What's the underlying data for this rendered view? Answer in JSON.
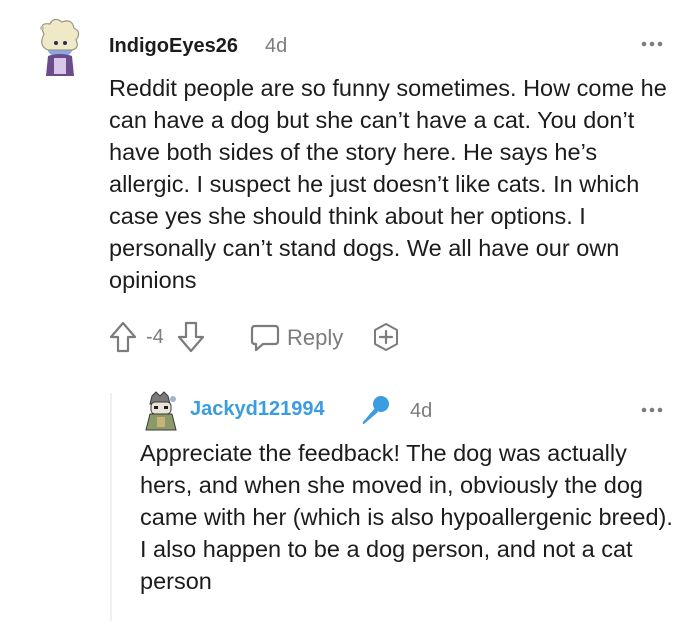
{
  "comment": {
    "author": "IndigoEyes26",
    "age": "4d",
    "body": "Reddit people are so funny sometimes. How come he can have a dog but she can’t have a cat. You don’t have both sides of the story here. He says he’s allergic. I suspect he just doesn’t like cats. In which case yes she should think about her options. I personally can’t stand dogs. We all have our own opinions",
    "score": "-4",
    "reply_label": "Reply",
    "icons": [
      "more-options-icon",
      "upvote-icon",
      "downvote-icon",
      "reply-icon",
      "award-icon"
    ]
  },
  "reply": {
    "author": "Jackyd121994",
    "age": "4d",
    "body": "Appreciate the feedback! The dog was actually hers, and when she moved in, obviously the dog came with her (which is also hypoallergenic breed). I also happen to be a dog person, and not a cat person",
    "icons": [
      "op-microphone-icon",
      "more-options-icon"
    ]
  },
  "colors": {
    "text": "#1c1c1c",
    "muted": "#7c7c7c",
    "op_username": "#3b9ce0",
    "thread_line": "#edeff1"
  }
}
